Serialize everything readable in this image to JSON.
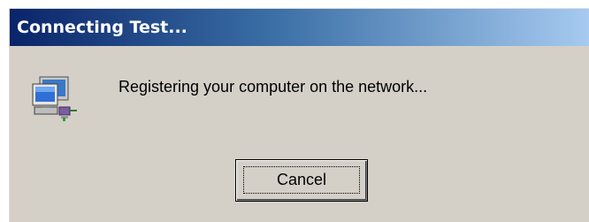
{
  "window": {
    "title": "Connecting Test..."
  },
  "dialog": {
    "icon": "network-computer-icon",
    "message": "Registering your computer on the network...",
    "cancel_label": "Cancel"
  },
  "colors": {
    "title_gradient_start": "#0a246a",
    "title_gradient_end": "#a6caf0",
    "dialog_background": "#d4d0c8"
  }
}
